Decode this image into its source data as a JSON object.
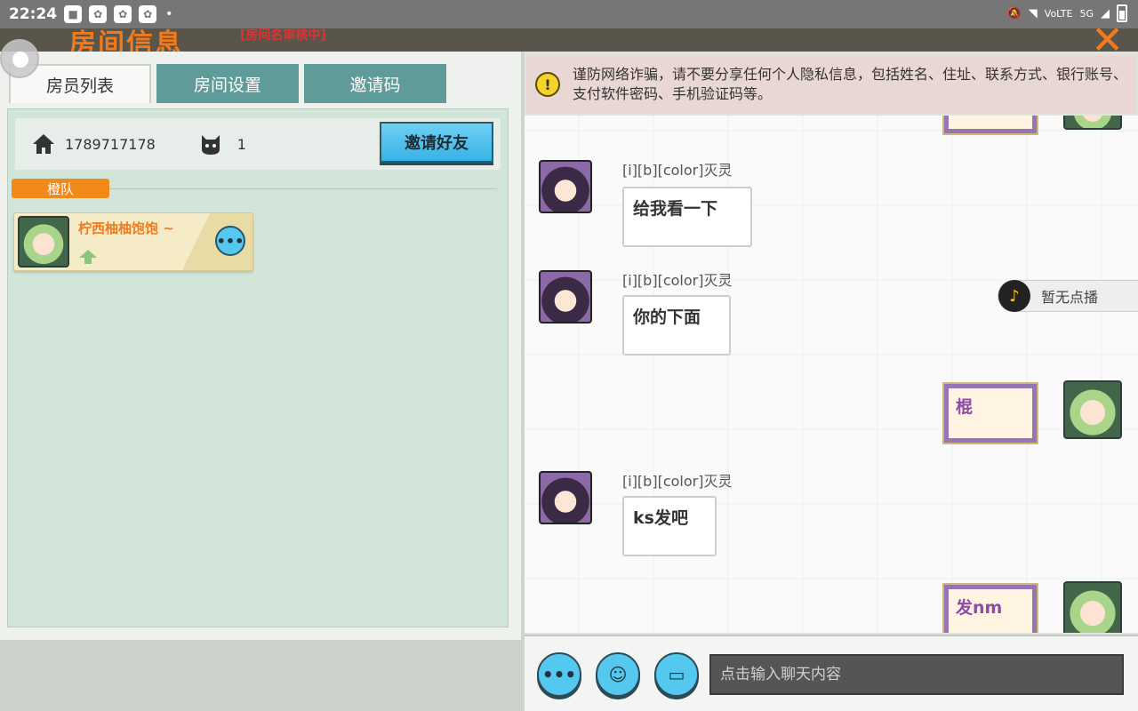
{
  "status_bar": {
    "time": "22:24",
    "network": "5G",
    "volte": "VoLTE"
  },
  "title_bar": {
    "title": "房间信息",
    "subtitle": "[房间名审核中]"
  },
  "tabs": [
    {
      "label": "房员列表",
      "active": true
    },
    {
      "label": "房间设置",
      "active": false
    },
    {
      "label": "邀请码",
      "active": false
    }
  ],
  "room": {
    "room_id": "1789717178",
    "member_count": "1",
    "invite_label": "邀请好友"
  },
  "team": {
    "label": "橙队"
  },
  "members": [
    {
      "name": "柠西柚柚饱饱 ~"
    }
  ],
  "warning": {
    "text": "谨防网络诈骗，请不要分享任何个人隐私信息，包括姓名、住址、联系方式、银行账号、支付软件密码、手机验证码等。"
  },
  "messages": [
    {
      "sender": "[i][b][color]灭灵",
      "text": "给我看一下",
      "self": false
    },
    {
      "sender": "[i][b][color]灭灵",
      "text": "你的下面",
      "self": false
    },
    {
      "sender": "",
      "text": "棍",
      "self": true
    },
    {
      "sender": "[i][b][color]灭灵",
      "text": "ks发吧",
      "self": false
    },
    {
      "sender": "",
      "text": "发nm",
      "self": true
    }
  ],
  "music": {
    "label": "暂无点播"
  },
  "input": {
    "placeholder": "点击输入聊天内容"
  },
  "colors": {
    "accent_orange": "#f07a1c",
    "button_blue": "#55c8ef",
    "tab_teal": "#5f9b98"
  }
}
